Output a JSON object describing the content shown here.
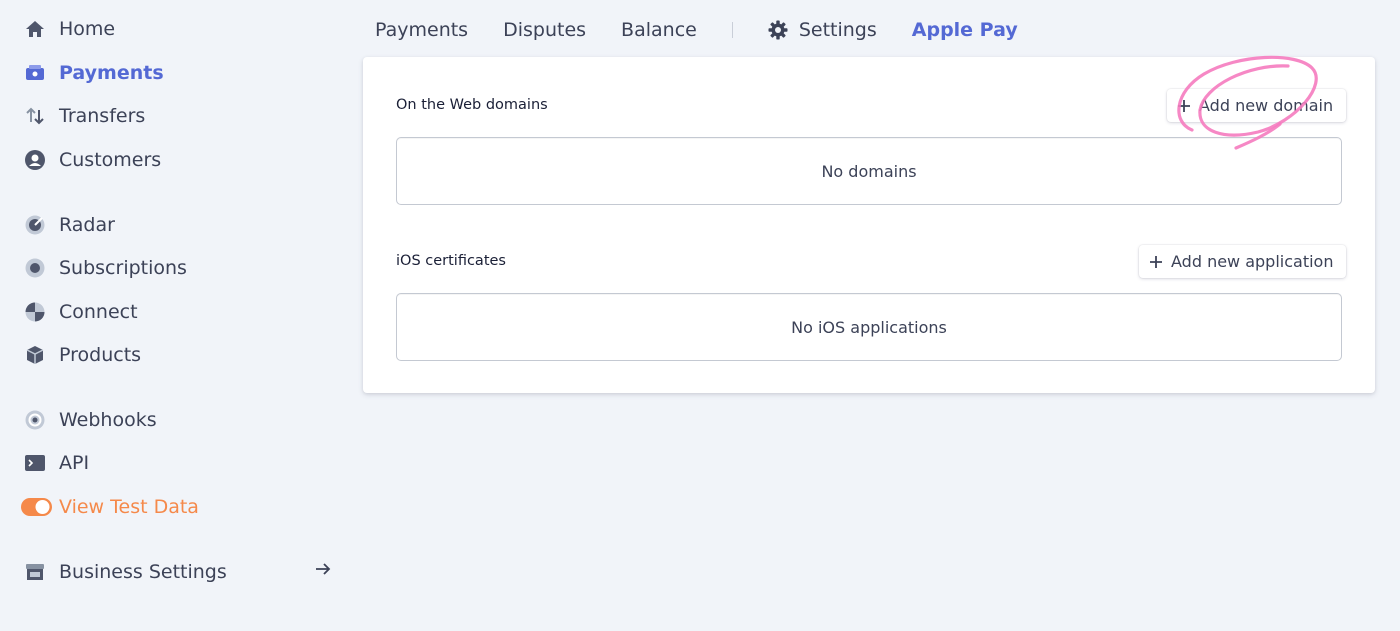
{
  "sidebar": {
    "items": [
      {
        "label": "Home",
        "icon": "home-icon"
      },
      {
        "label": "Payments",
        "icon": "payments-icon",
        "active": true
      },
      {
        "label": "Transfers",
        "icon": "transfers-icon"
      },
      {
        "label": "Customers",
        "icon": "customers-icon"
      },
      {
        "label": "Radar",
        "icon": "radar-icon"
      },
      {
        "label": "Subscriptions",
        "icon": "subscriptions-icon"
      },
      {
        "label": "Connect",
        "icon": "connect-icon"
      },
      {
        "label": "Products",
        "icon": "products-icon"
      },
      {
        "label": "Webhooks",
        "icon": "webhooks-icon"
      },
      {
        "label": "API",
        "icon": "terminal-icon"
      },
      {
        "label": "View Test Data",
        "icon": "toggle-icon",
        "toggle_on": true
      },
      {
        "label": "Business Settings",
        "icon": "store-icon"
      }
    ]
  },
  "tabs": [
    {
      "label": "Payments"
    },
    {
      "label": "Disputes"
    },
    {
      "label": "Balance"
    },
    {
      "label": "Settings",
      "icon": "gear-icon"
    },
    {
      "label": "Apple Pay",
      "active": true
    }
  ],
  "web_domains": {
    "title": "On the Web domains",
    "add_label": "Add new domain",
    "empty_text": "No domains"
  },
  "ios_certificates": {
    "title": "iOS certificates",
    "add_label": "Add new application",
    "empty_text": "No iOS applications"
  },
  "colors": {
    "accent": "#5469d4",
    "text": "#3c4257",
    "icon": "#4f566b",
    "toggle": "#f5894a",
    "annotation": "#f57bbf",
    "background": "#f1f4f9"
  }
}
